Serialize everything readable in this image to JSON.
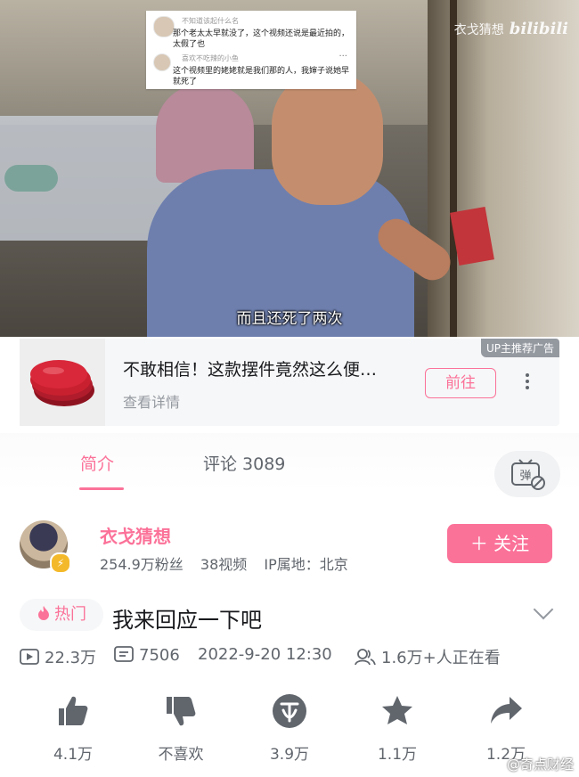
{
  "video": {
    "watermark_channel": "衣戈猜想",
    "watermark_brand": "bilibili",
    "subtitle": "而且还死了两次",
    "comment_overlay": [
      {
        "name": "不知道该起什么名",
        "text": "那个老太太早就没了，这个视频还说是最近拍的，太假了也"
      },
      {
        "name": "喜欢不吃辣的小鱼",
        "text": "这个视频里的姥姥就是我们那的人，我婶子说她早就死了"
      }
    ]
  },
  "ad": {
    "tag": "UP主推荐广告",
    "title": "不敢相信！这款摆件竟然这么便…",
    "subtitle": "查看详情",
    "button": "前往"
  },
  "tabs": [
    {
      "label": "简介",
      "active": true
    },
    {
      "label": "评论 3089",
      "active": false
    }
  ],
  "danmaku_icon": "弹",
  "author": {
    "name": "衣戈猜想",
    "fans": "254.9万粉丝",
    "videos": "38视频",
    "ip": "IP属地：北京",
    "follow_label": "＋ 关注"
  },
  "video_info": {
    "hot_tag": "热门",
    "title": "我来回应一下吧",
    "plays": "22.3万",
    "danmaku_count": "7506",
    "datetime": "2022-9-20 12:30",
    "watching": "1.6万+人正在看"
  },
  "actions": [
    {
      "icon": "thumbs-up-icon",
      "label": "4.1万"
    },
    {
      "icon": "thumbs-down-icon",
      "label": "不喜欢"
    },
    {
      "icon": "coin-icon",
      "label": "3.9万"
    },
    {
      "icon": "star-icon",
      "label": "1.1万"
    },
    {
      "icon": "share-icon",
      "label": "1.2万"
    }
  ],
  "weibo_watermark": "@奇点财经",
  "colors": {
    "accent": "#fb7299",
    "text": "#18191c",
    "muted": "#61666d"
  }
}
